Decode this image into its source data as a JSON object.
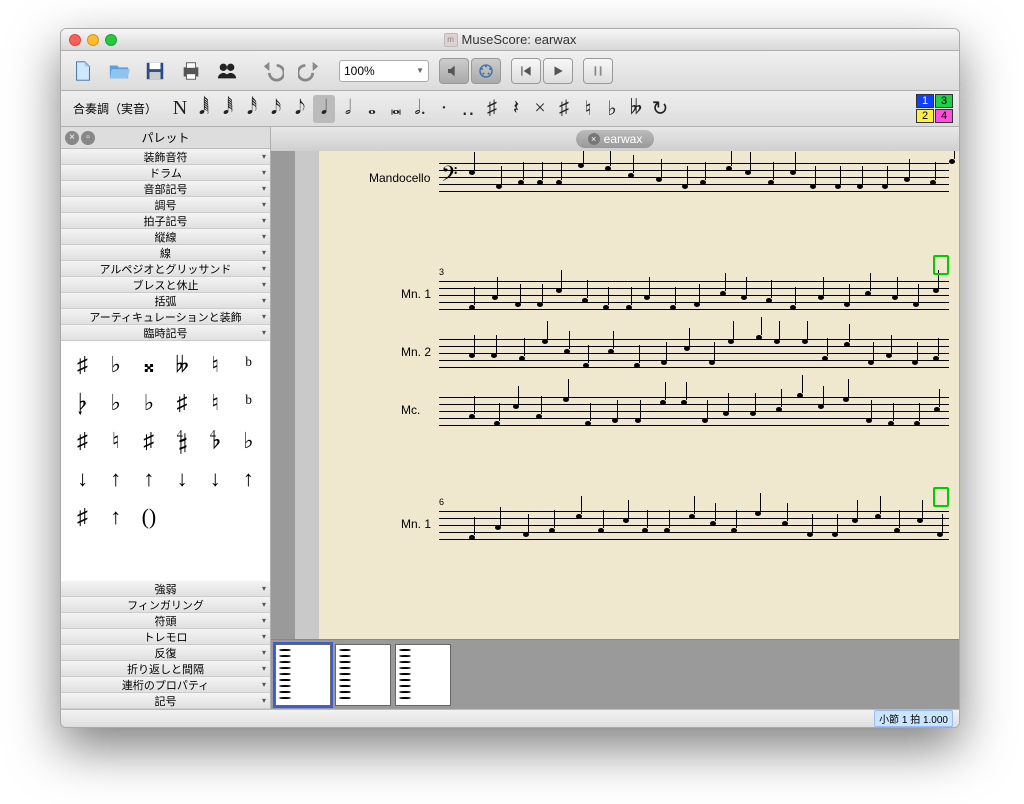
{
  "window": {
    "title": "MuseScore: earwax"
  },
  "toolbar": {
    "zoom": "100%",
    "concert_pitch": "合奏調（実音）",
    "note_durations": [
      "N",
      "𝅘𝅥𝅲",
      "𝅘𝅥𝅱",
      "𝅘𝅥𝅰",
      "𝅘𝅥𝅯",
      "𝅘𝅥𝅮",
      "𝅘𝅥",
      "𝅗𝅥",
      "𝅝",
      "𝅜",
      "𝅗𝅥.",
      "·",
      "‥",
      "♯",
      "𝄽",
      "×",
      "♯",
      "♮",
      "♭",
      "𝄫",
      "↻"
    ],
    "voices": [
      "1",
      "2",
      "3",
      "4"
    ]
  },
  "sidebar": {
    "title": "パレット",
    "groups_top": [
      "装飾音符",
      "ドラム",
      "音部記号",
      "調号",
      "拍子記号",
      "縦線",
      "線",
      "アルペジオとグリッサンド",
      "ブレスと休止",
      "括弧",
      "アーティキュレーションと装飾",
      "臨時記号"
    ],
    "accidentals": [
      "♯",
      "♭",
      "𝄪",
      "𝄫",
      "♮",
      "ᵇ",
      "𝄭",
      "♭",
      "♭",
      "♯",
      "♮",
      "ᵇ",
      "♯",
      "♮",
      "♯",
      "𝄲",
      "𝄳",
      "♭",
      "↓",
      "↑",
      "↑",
      "↓",
      "↓",
      "↑",
      "♯",
      "↑",
      "()",
      " "
    ],
    "groups_bottom": [
      "強弱",
      "フィンガリング",
      "符頭",
      "トレモロ",
      "反復",
      "折り返しと間隔",
      "連桁のプロパティ",
      "記号"
    ]
  },
  "tab": {
    "label": "earwax"
  },
  "score": {
    "instrument_top": "Mandocello",
    "staves": [
      "Mn. 1",
      "Mn. 2",
      "Mc."
    ],
    "measure3": "3",
    "staff_bottom": "Mn. 1",
    "measure6": "6"
  },
  "status": {
    "measure_label": "小節",
    "measure": "1",
    "beat_label": "拍",
    "beat": "1.000"
  }
}
